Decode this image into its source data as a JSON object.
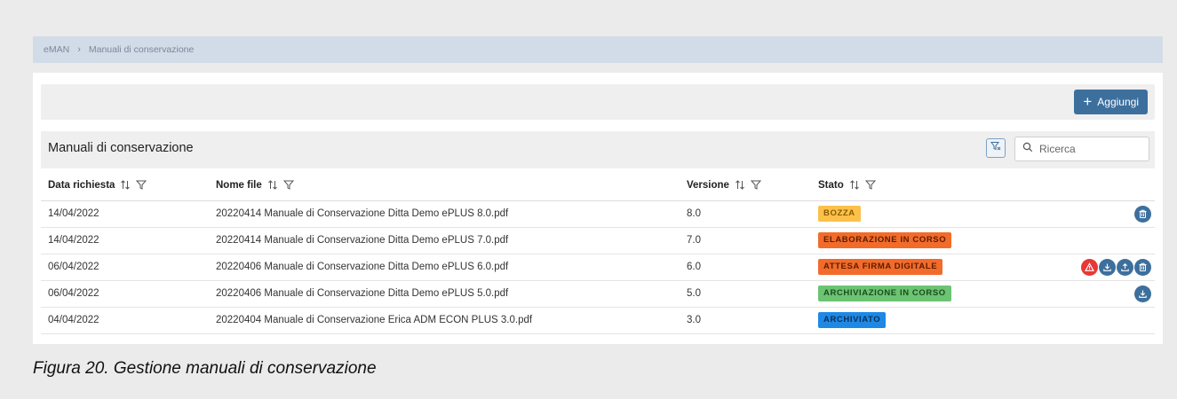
{
  "breadcrumb": {
    "root": "eMAN",
    "separator": "›",
    "current": "Manuali di conservazione"
  },
  "toolbar": {
    "add_label": "Aggiungi",
    "add_icon": "plus-icon"
  },
  "table": {
    "title": "Manuali di conservazione",
    "search_placeholder": "Ricerca",
    "columns": [
      {
        "label": "Data richiesta"
      },
      {
        "label": "Nome file"
      },
      {
        "label": "Versione"
      },
      {
        "label": "Stato"
      }
    ],
    "rows": [
      {
        "date": "14/04/2022",
        "file": "20220414 Manuale di Conservazione Ditta Demo ePLUS 8.0.pdf",
        "version": "8.0",
        "status": "BOZZA",
        "status_bg": "#fbc14a",
        "status_fg": "#8a5a00",
        "actions": [
          "delete-icon"
        ]
      },
      {
        "date": "14/04/2022",
        "file": "20220414 Manuale di Conservazione Ditta Demo ePLUS 7.0.pdf",
        "version": "7.0",
        "status": "ELABORAZIONE IN CORSO",
        "status_bg": "#f26b2b",
        "status_fg": "#5a1e00",
        "actions": []
      },
      {
        "date": "06/04/2022",
        "file": "20220406 Manuale di Conservazione Ditta Demo ePLUS 6.0.pdf",
        "version": "6.0",
        "status": "ATTESA FIRMA DIGITALE",
        "status_bg": "#f26b2b",
        "status_fg": "#5a1e00",
        "actions": [
          "warning-icon",
          "download-icon",
          "upload-icon",
          "delete-icon"
        ]
      },
      {
        "date": "06/04/2022",
        "file": "20220406 Manuale di Conservazione Ditta Demo ePLUS 5.0.pdf",
        "version": "5.0",
        "status": "ARCHIVIAZIONE IN CORSO",
        "status_bg": "#6cc372",
        "status_fg": "#1a4d1f",
        "actions": [
          "download-icon"
        ]
      },
      {
        "date": "04/04/2022",
        "file": "20220404 Manuale di Conservazione Erica ADM ECON PLUS 3.0.pdf",
        "version": "3.0",
        "status": "ARCHIVIATO",
        "status_bg": "#1e88e5",
        "status_fg": "#0b2f55",
        "actions": []
      }
    ]
  },
  "caption": "Figura 20. Gestione manuali di conservazione",
  "colors": {
    "accent": "#3d6f9d",
    "action_icon": "#3d6f9d",
    "warning_icon": "#e53935"
  }
}
